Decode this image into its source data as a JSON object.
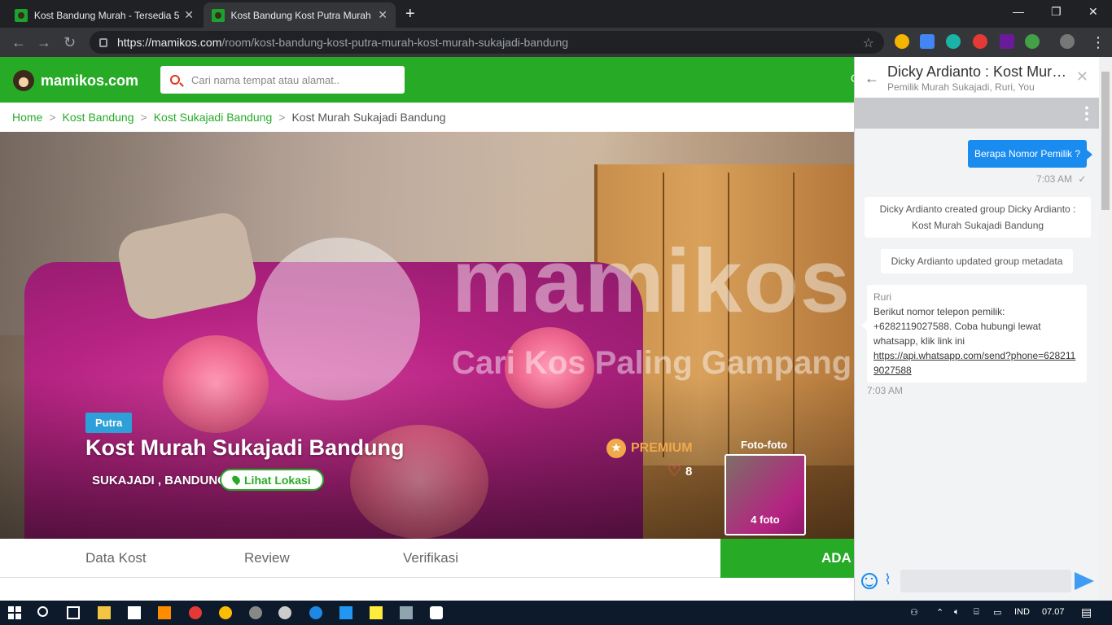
{
  "browser": {
    "tabs": [
      {
        "title": "Kost Bandung Murah - Tersedia 5",
        "close": "✕"
      },
      {
        "title": "Kost Bandung Kost Putra Murah K",
        "close": "✕"
      }
    ],
    "new_tab": "+",
    "url_host": "https://mamikos.com",
    "url_path": "/room/kost-bandung-kost-putra-murah-kost-murah-sukajadi-bandung"
  },
  "site": {
    "logo": "mamikos.com",
    "search_placeholder": "Cari nama tempat atau alamat..",
    "header_right": "C"
  },
  "breadcrumb": [
    "Home",
    "Kost Bandung",
    "Kost Sukajadi Bandung",
    "Kost Murah Sukajadi Bandung"
  ],
  "room": {
    "badge": "Putra",
    "title": "Kost Murah Sukajadi Bandung",
    "location": "SUKAJADI , BANDUNG",
    "location_button": "Lihat Lokasi",
    "premium": "PREMIUM",
    "likes": "8",
    "photos_label": "Foto-foto",
    "photos_count": "4 foto",
    "watermark": "mamikos",
    "watermark_sub": "Cari Kos Paling Gampang &"
  },
  "tabs": [
    "Data Kost",
    "Review",
    "Verifikasi"
  ],
  "cta": "ADA S",
  "chat": {
    "title": "Dicky Ardianto : Kost Murah Sukajadi Bandung",
    "subtitle": "Pemilik Murah Sukajadi, Ruri, You",
    "messages": {
      "outgoing": "Berapa Nomor Pemilik ?",
      "outgoing_time": "7:03 AM",
      "system1": "Dicky Ardianto created group Dicky Ardianto : Kost Murah Sukajadi Bandung",
      "system2": "Dicky Ardianto updated group metadata",
      "incoming_sender": "Ruri",
      "incoming_text": "Berikut nomor telepon pemilik: +6282119027588. Coba hubungi lewat whatsapp, klik link ini",
      "incoming_link": "https://api.whatsapp.com/send?phone=6282119027588",
      "incoming_time": "7:03 AM"
    }
  },
  "taskbar": {
    "lang": "IND",
    "time": "07.07"
  }
}
